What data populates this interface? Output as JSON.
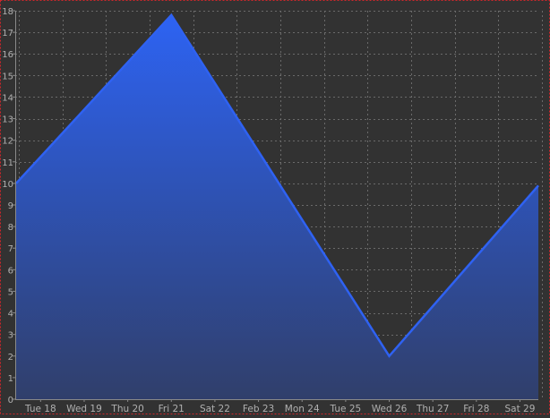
{
  "chart_data": {
    "type": "area",
    "x": [
      "Tue 18",
      "Wed 19",
      "Thu 20",
      "Fri 21",
      "Sat 22",
      "Feb 23",
      "Mon 24",
      "Tue 25",
      "Wed 26",
      "Thu 27",
      "Fri 28",
      "Sat 29"
    ],
    "points": [
      {
        "x": "Mon 17",
        "y": 10
      },
      {
        "x": "Fri 21",
        "y": 17.8
      },
      {
        "x": "Wed 26",
        "y": 2
      },
      {
        "x": "Sat 29",
        "y": 9.9
      }
    ],
    "ylim": [
      0,
      18
    ],
    "yticks": [
      0,
      1,
      2,
      3,
      4,
      5,
      6,
      7,
      8,
      9,
      10,
      11,
      12,
      13,
      14,
      15,
      16,
      17,
      18
    ],
    "grid": true,
    "title": "",
    "xlabel": "",
    "ylabel": "",
    "colors": {
      "background": "#323232",
      "grid": "#6a6a6a",
      "frame": "#d0262b",
      "axis": "#8a8a8a",
      "tick_label": "#b0b0b0",
      "line": "#2f62f2",
      "fill_top": "#2d63f3",
      "fill_bottom": "#303f6b"
    }
  }
}
